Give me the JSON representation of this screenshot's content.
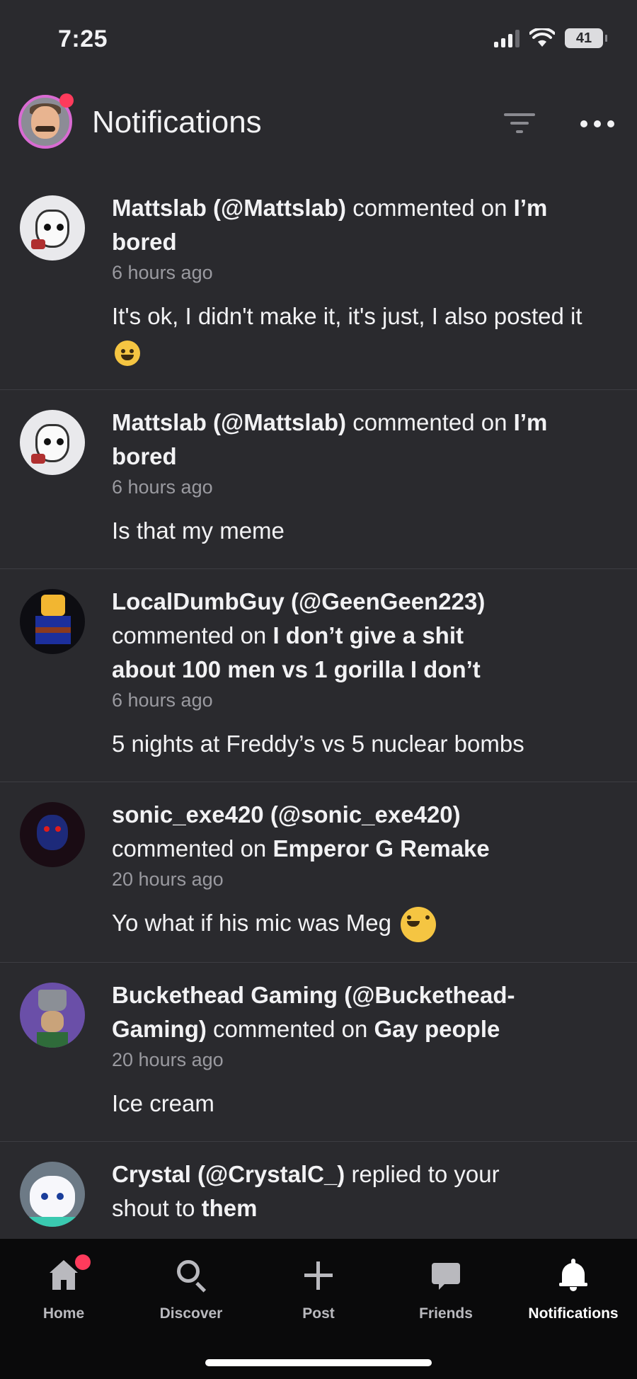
{
  "status_bar": {
    "time": "7:25",
    "battery": "41"
  },
  "header": {
    "title": "Notifications"
  },
  "notifications": [
    {
      "user": "Mattslab (@Mattslab)",
      "action": " commented on ",
      "target": "I’m bored",
      "time": "6 hours ago",
      "comment": "It's ok, I didn't make it, it's just, I also posted it",
      "emoji": "sweat-smile-emoji"
    },
    {
      "user": "Mattslab (@Mattslab)",
      "action": " commented on ",
      "target": "I’m bored",
      "time": "6 hours ago",
      "comment": "Is that my meme"
    },
    {
      "user": "LocalDumbGuy (@GeenGeen223)",
      "action": " commented on ",
      "target": "I don’t give a shit about 100 men vs 1 gorilla I don’t",
      "time": "6 hours ago",
      "comment": "5 nights at Freddy’s vs 5 nuclear bombs"
    },
    {
      "user": "sonic_exe420 (@sonic_exe420)",
      "action": " commented on ",
      "target": "Emperor G Remake",
      "time": "20 hours ago",
      "comment": "Yo what if his mic was Meg",
      "emoji": "rolling-laughing-emoji"
    },
    {
      "user": "Buckethead Gaming (@Buckethead-Gaming)",
      "action": " commented on ",
      "target": "Gay people",
      "time": "20 hours ago",
      "comment": "Ice cream"
    },
    {
      "user": "Crystal (@CrystalC_)",
      "action": " replied to your shout to ",
      "target": "them"
    }
  ],
  "tabs": [
    {
      "label": "Home",
      "icon": "home-icon"
    },
    {
      "label": "Discover",
      "icon": "search-icon"
    },
    {
      "label": "Post",
      "icon": "plus-icon"
    },
    {
      "label": "Friends",
      "icon": "chat-icon"
    },
    {
      "label": "Notifications",
      "icon": "bell-icon",
      "active": true
    }
  ],
  "colors": {
    "background": "#2a2a2e",
    "tab_bar": "#0a0a0b",
    "badge": "#ff3b5c",
    "avatar_ring": "#d96bd3"
  }
}
